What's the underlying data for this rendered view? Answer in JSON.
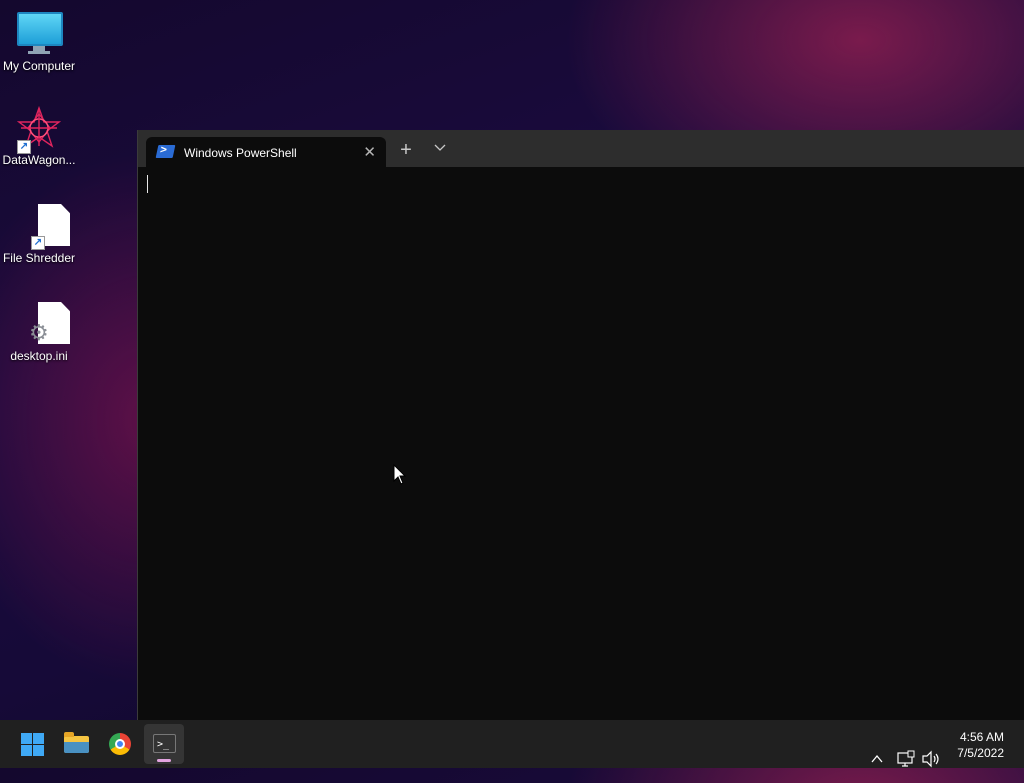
{
  "desktop": {
    "icons": [
      {
        "label": "My Computer",
        "icon": "monitor-icon"
      },
      {
        "label": "DataWagon...",
        "icon": "datawagon-icon"
      },
      {
        "label": "File Shredder",
        "icon": "file-shortcut-icon"
      },
      {
        "label": "desktop.ini",
        "icon": "settings-file-icon"
      }
    ]
  },
  "terminal": {
    "tab_title": "Windows PowerShell",
    "tab_icon": "powershell-icon",
    "close_glyph": "✕",
    "new_tab_glyph": "+",
    "ps_glyph": ">"
  },
  "taskbar": {
    "apps": [
      {
        "name": "Start",
        "icon": "windows-start-icon"
      },
      {
        "name": "File Explorer",
        "icon": "folder-icon"
      },
      {
        "name": "Google Chrome",
        "icon": "chrome-icon"
      },
      {
        "name": "Terminal",
        "icon": "terminal-icon",
        "active": true,
        "glyph": ">_"
      }
    ],
    "tray": {
      "chevron_glyph": "^",
      "time": "4:56 AM",
      "date": "7/5/2022"
    }
  },
  "colors": {
    "terminal_bg": "#0c0c0c",
    "titlebar_bg": "#2d2d2d",
    "taskbar_bg": "#202020",
    "start_blue": "#3fa9f5",
    "active_indicator": "#e3a4e0"
  }
}
